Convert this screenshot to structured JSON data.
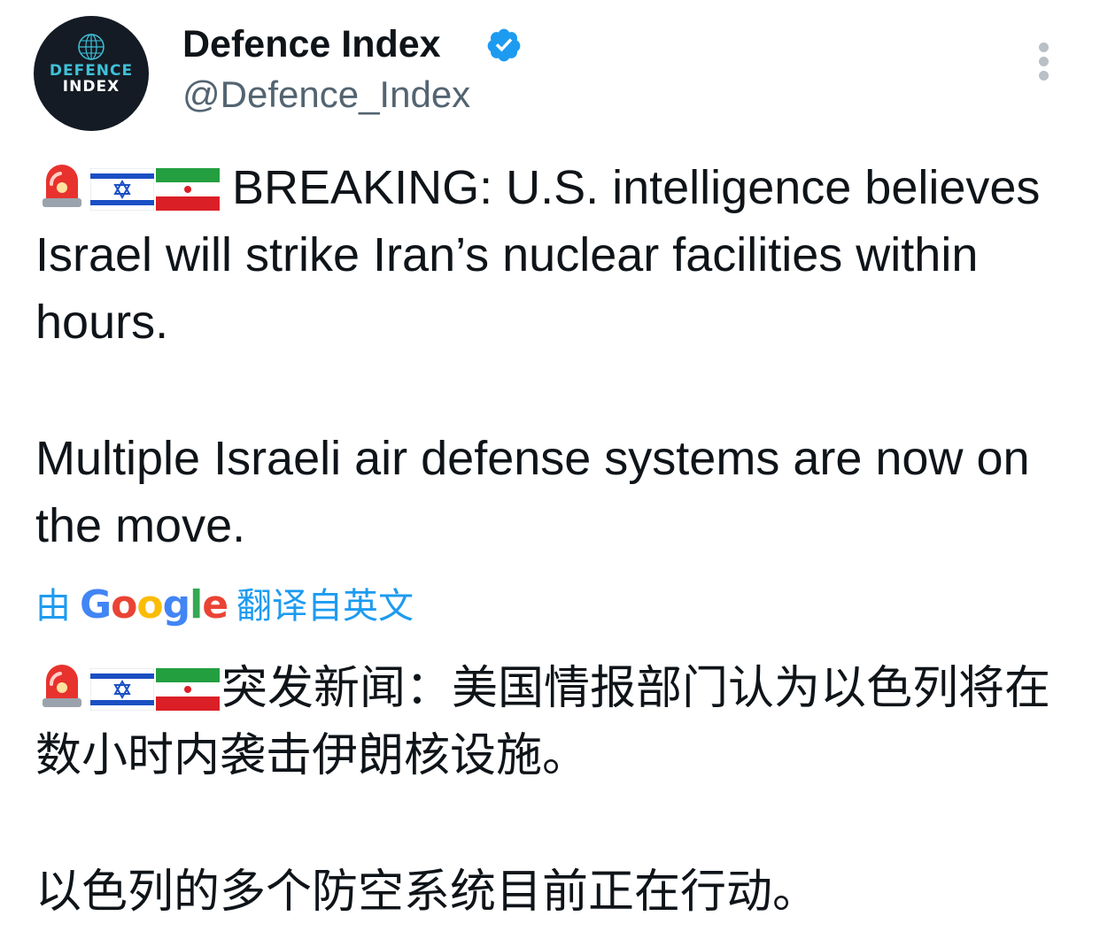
{
  "account": {
    "display_name": "Defence Index",
    "handle": "@Defence_Index",
    "verified": true,
    "avatar_text_line1": "DEFENCE",
    "avatar_text_line2": "INDEX"
  },
  "tweet": {
    "lead_emojis": [
      "rotating-light-emoji",
      "israel-flag-emoji",
      "iran-flag-emoji"
    ],
    "paragraph1": "BREAKING: U.S. intelligence believes Israel will strike Iran’s nuclear facilities within hours.",
    "paragraph2": "Multiple Israeli air defense systems are now on the move."
  },
  "translation": {
    "prefix": "由",
    "provider": "Google",
    "suffix": "翻译自英文",
    "paragraph1": "突发新闻：美国情报部门认为以色列将在数小时内袭击伊朗核设施。",
    "paragraph2": "以色列的多个防空系统目前正在行动。"
  },
  "colors": {
    "text": "#0f1419",
    "secondary_text": "#536471",
    "accent": "#1d9bf0",
    "avatar_bg": "#141b24"
  }
}
